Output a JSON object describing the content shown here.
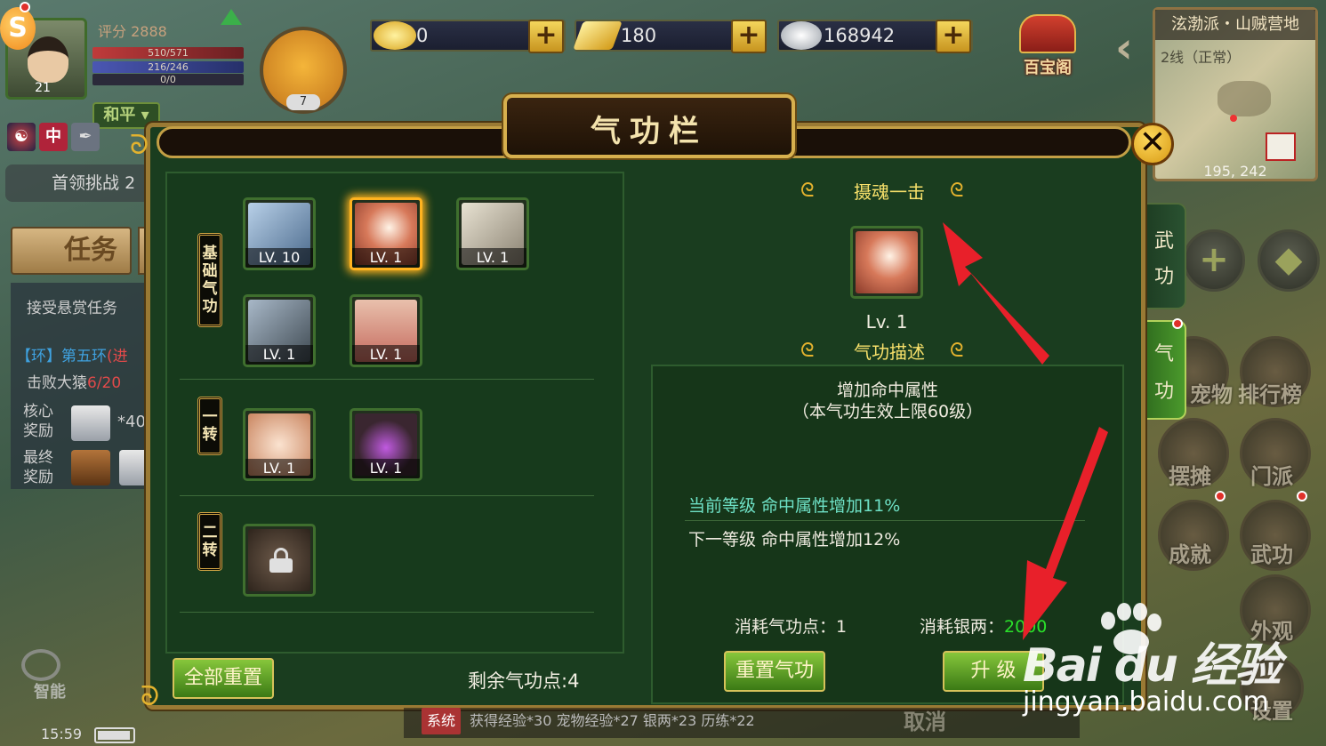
{
  "player": {
    "score_label": "评分 2888",
    "level": "21",
    "hp": "510/571",
    "mp": "216/246",
    "xp": "0/0",
    "pet_level": "7",
    "mode": "和平",
    "faction_tag": "中"
  },
  "left_panel": {
    "boss_challenge": "首领挑战",
    "boss_challenge_suffix": "2",
    "task_tab": "任务",
    "accept_bounty": "接受悬赏任务",
    "ring_quest_prefix": "【环】第五环",
    "ring_quest_suffix": "(进",
    "defeat_text": "击败大猿",
    "defeat_progress": "6/20",
    "core_reward_label": "核心\n奖励",
    "core_reward_count": "*40",
    "final_reward_label": "最终\n奖励"
  },
  "resources": [
    {
      "name": "gold-ingot",
      "value": "0",
      "color": "#f2c230"
    },
    {
      "name": "gold-bar",
      "value": "180",
      "color": "#f5c638"
    },
    {
      "name": "silver-ingot",
      "value": "168942",
      "color": "#d8dce2"
    }
  ],
  "baibao": "百宝阁",
  "minimap": {
    "title": "泫渤派・山贼营地",
    "line": "2线（正常）",
    "coords": "195, 242"
  },
  "right_side": {
    "tab_wugong": [
      "武",
      "功"
    ],
    "tab_qigong": [
      "气",
      "功"
    ],
    "menu": [
      "宠物",
      "排行榜",
      "摆摊",
      "门派",
      "成就",
      "武功",
      "外观",
      "设置"
    ]
  },
  "dialog": {
    "title": "气功栏",
    "categories": [
      {
        "label": "基础气功",
        "skills": [
          {
            "name": "skill-fist-icon",
            "lv": "LV. 10",
            "color": "#5c7fa6"
          },
          {
            "name": "skill-strike-icon",
            "lv": "LV. 1",
            "color": "#c5664a",
            "selected": true
          },
          {
            "name": "skill-scroll-icon",
            "lv": "LV. 1",
            "color": "#a69d89"
          },
          {
            "name": "skill-armor-icon",
            "lv": "LV. 1",
            "color": "#5f6e77"
          },
          {
            "name": "skill-hero-icon",
            "lv": "LV. 1",
            "color": "#d59b88"
          }
        ]
      },
      {
        "label": "一转",
        "skills": [
          {
            "name": "skill-palm-icon",
            "lv": "LV. 1",
            "color": "#d89e7a"
          },
          {
            "name": "skill-orb-icon",
            "lv": "LV. 1",
            "color": "#6a4a76"
          }
        ]
      },
      {
        "label": "二转",
        "skills": [
          {
            "name": "skill-locked-icon",
            "lv": "",
            "color": "#4c3e33"
          }
        ]
      }
    ],
    "reset_all": "全部重置",
    "remaining_points": "剩余气功点:4",
    "detail": {
      "skill_name": "摄魂一击",
      "level": "Lv. 1",
      "desc_header": "气功描述",
      "desc_line1": "增加命中属性",
      "desc_line2": "（本气功生效上限60级）",
      "current_level": "当前等级  命中属性增加11%",
      "next_level": "下一等级  命中属性增加12%",
      "cost_points_label": "消耗气功点：",
      "cost_points_value": "1",
      "cost_silver_label": "消耗银两：",
      "cost_silver_value": "2000",
      "reset_button": "重置气功",
      "upgrade_button": "升  级"
    }
  },
  "bottom": {
    "time": "15:59",
    "chat_tag": "系统",
    "chat_text": "获得经验*30  宠物经验*27  银两*23  历练*22",
    "cancel": "取消",
    "smart": "智能"
  },
  "watermark": {
    "logo": "Bai du 经验",
    "url": "jingyan.baidu.com"
  }
}
